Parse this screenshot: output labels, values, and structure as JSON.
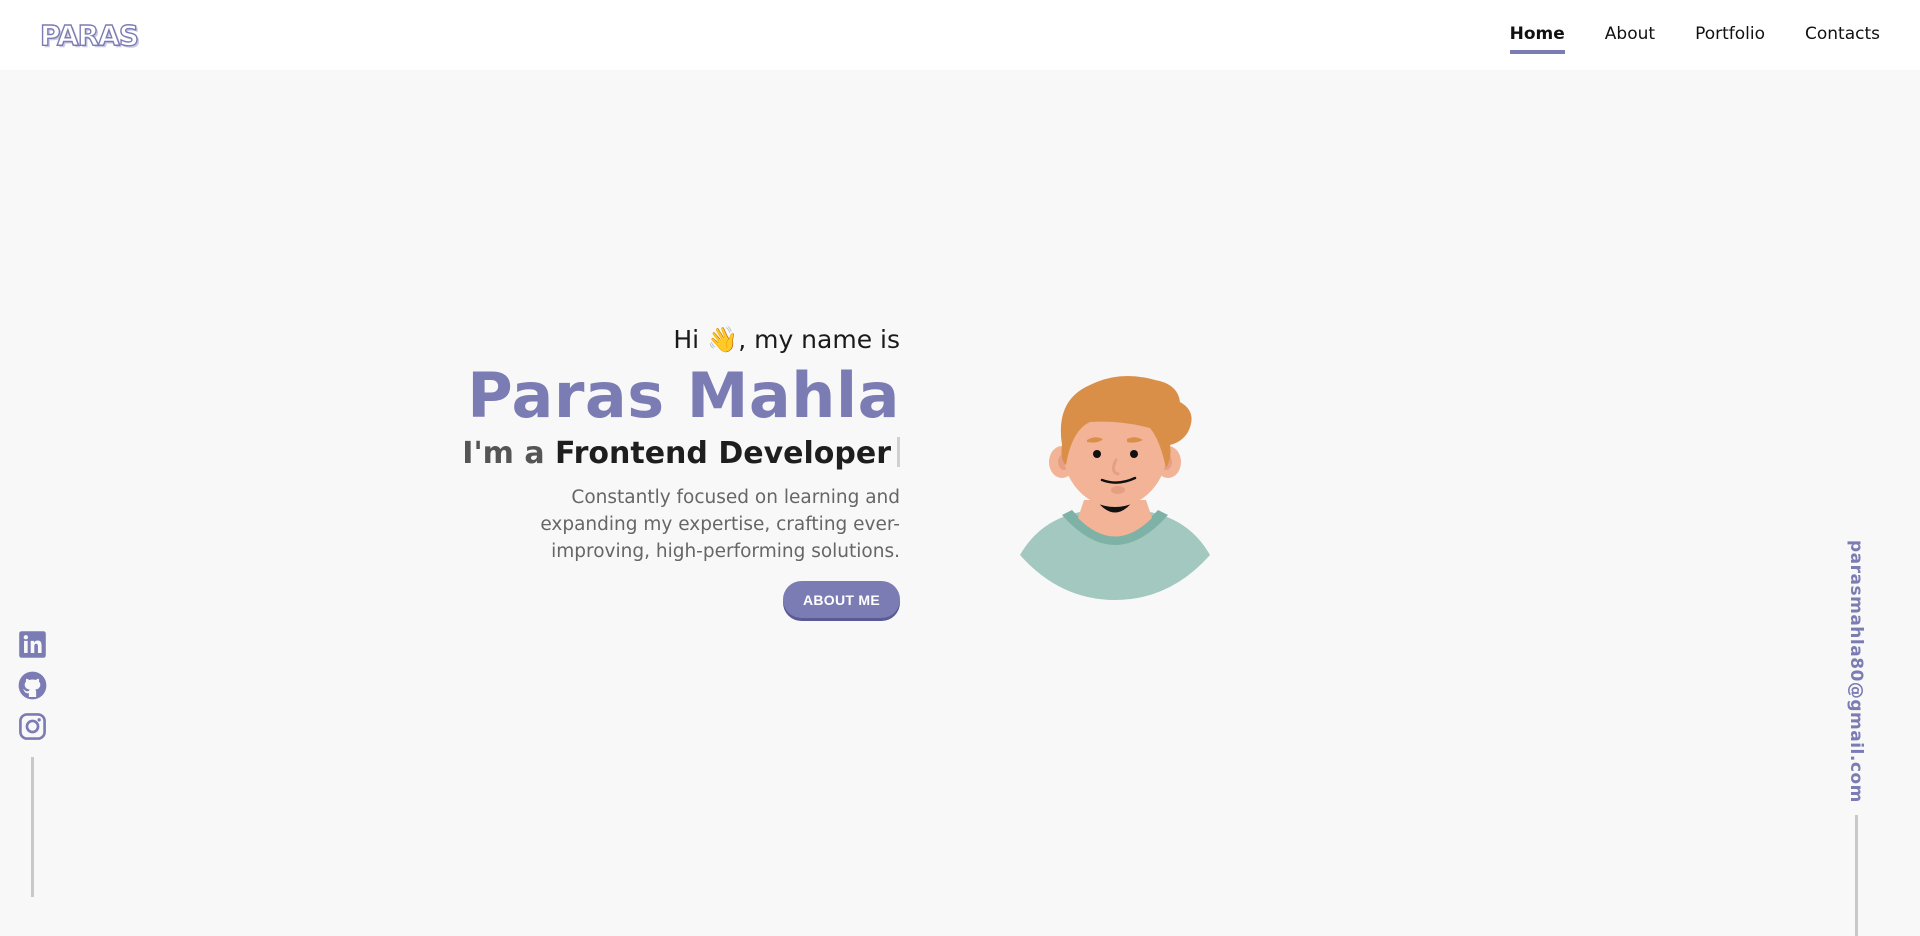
{
  "header": {
    "logo": "PARAS",
    "nav": [
      {
        "label": "Home",
        "active": true
      },
      {
        "label": "About",
        "active": false
      },
      {
        "label": "Portfolio",
        "active": false
      },
      {
        "label": "Contacts",
        "active": false
      }
    ]
  },
  "hero": {
    "greeting": "Hi 👋, my name is",
    "name": "Paras Mahla",
    "role_prefix": "I'm a ",
    "role_value": "Frontend Developer",
    "tagline": "Constantly focused on learning and expanding my expertise, crafting ever-improving, high-performing solutions.",
    "button_label": "ABOUT ME"
  },
  "social": {
    "icons": [
      "linkedin-icon",
      "github-icon",
      "instagram-icon"
    ]
  },
  "contact": {
    "email": "parasmahla80@gmail.com"
  },
  "colors": {
    "accent": "#7c7cb4",
    "background": "#f8f8f8",
    "header": "#ffffff"
  }
}
